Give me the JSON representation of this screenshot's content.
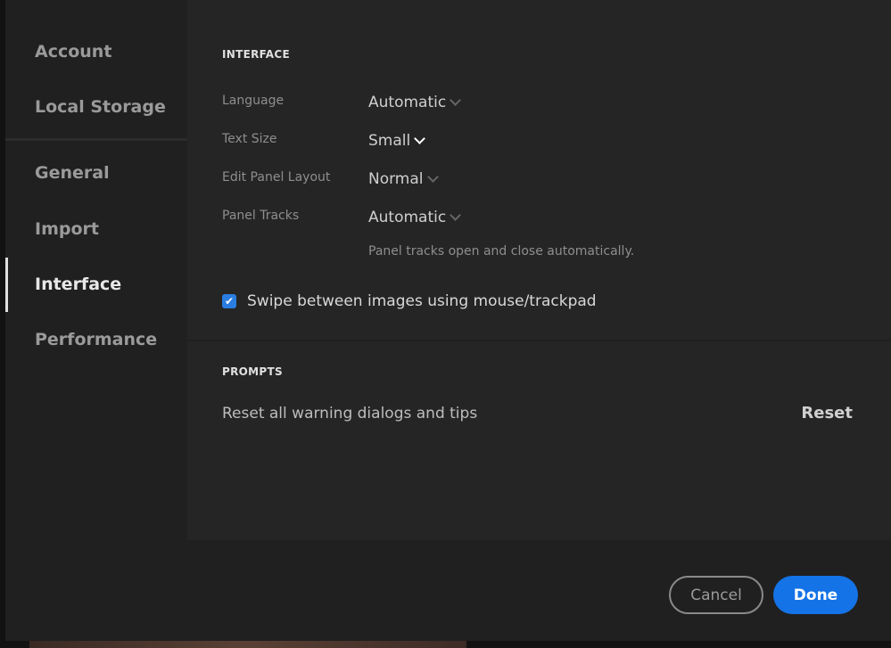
{
  "sidebar": {
    "items": [
      "Account",
      "Local Storage",
      "General",
      "Import",
      "Interface",
      "Performance"
    ],
    "active": "Interface"
  },
  "interface": {
    "heading": "INTERFACE",
    "language": {
      "label": "Language",
      "value": "Automatic"
    },
    "text_size": {
      "label": "Text Size",
      "value": "Small"
    },
    "edit_panel_layout": {
      "label": "Edit Panel Layout",
      "value": "Normal"
    },
    "panel_tracks": {
      "label": "Panel Tracks",
      "value": "Automatic",
      "hint": "Panel tracks open and close automatically."
    },
    "swipe": {
      "label": "Swipe between images using mouse/trackpad",
      "checked": true
    }
  },
  "prompts": {
    "heading": "PROMPTS",
    "label": "Reset all warning dialogs and tips",
    "button": "Reset"
  },
  "footer": {
    "cancel": "Cancel",
    "done": "Done"
  },
  "colors": {
    "accent": "#1473e6",
    "checkbox": "#2a7de1"
  }
}
